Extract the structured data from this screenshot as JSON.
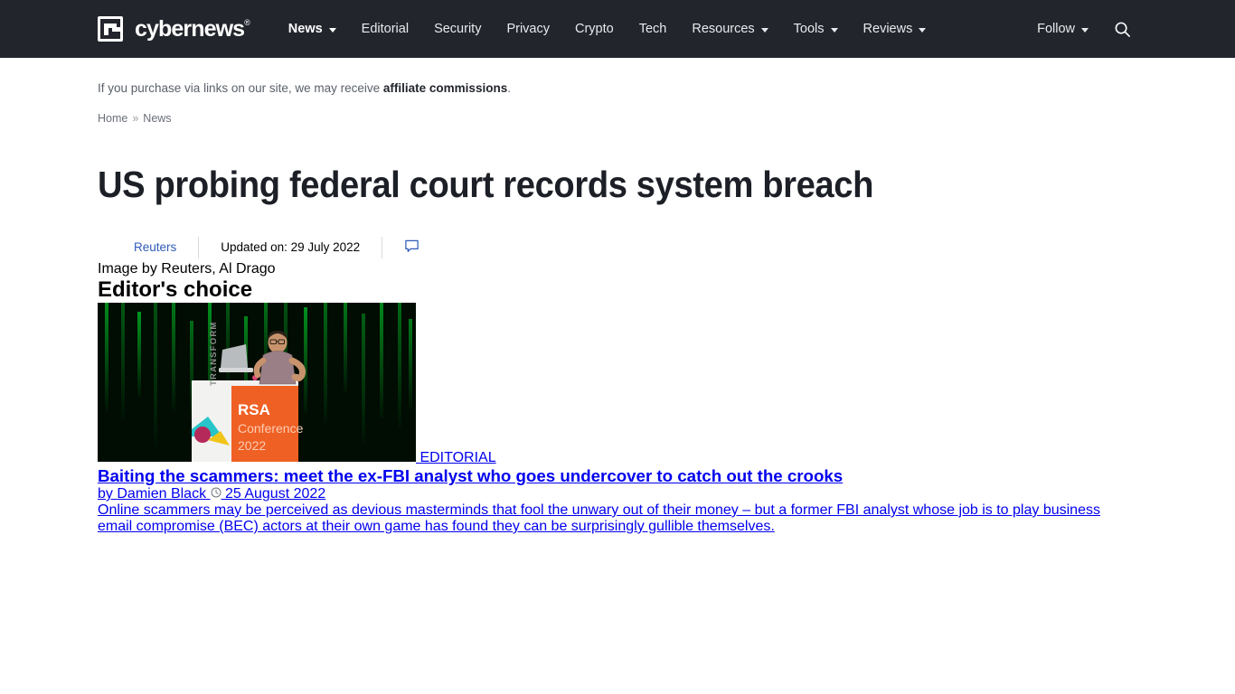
{
  "header": {
    "brand": {
      "name": "cybernews",
      "registered_mark": "®",
      "logo_icon": "cybernews-logo-icon"
    },
    "nav": [
      {
        "label": "News",
        "has_dropdown": true,
        "active": true
      },
      {
        "label": "Editorial",
        "has_dropdown": false,
        "active": false
      },
      {
        "label": "Security",
        "has_dropdown": false,
        "active": false
      },
      {
        "label": "Privacy",
        "has_dropdown": false,
        "active": false
      },
      {
        "label": "Crypto",
        "has_dropdown": false,
        "active": false
      },
      {
        "label": "Tech",
        "has_dropdown": false,
        "active": false
      },
      {
        "label": "Resources",
        "has_dropdown": true,
        "active": false
      },
      {
        "label": "Tools",
        "has_dropdown": true,
        "active": false
      },
      {
        "label": "Reviews",
        "has_dropdown": true,
        "active": false
      }
    ],
    "follow": {
      "label": "Follow",
      "has_dropdown": true
    },
    "search_icon": "search-icon",
    "background_color": "#22252c"
  },
  "affiliate": {
    "text_before": "If you purchase via links on our site, we may receive ",
    "emphasis": "affiliate commissions",
    "text_after": "."
  },
  "breadcrumb": {
    "items": [
      {
        "label": "Home"
      },
      {
        "label": "News"
      }
    ],
    "separator": "»"
  },
  "article": {
    "title": "US probing federal court records system breach",
    "author": "Reuters",
    "updated_label": "Updated on: 29 July 2022",
    "comment_icon": "comment-bubble-icon",
    "hero_caption": "Image by Reuters, Al Drago"
  },
  "sidebar": {
    "heading": "Editor's choice",
    "card": {
      "badge": "EDITORIAL",
      "title": "Baiting the scammers: meet the ex-FBI analyst who goes undercover to catch out the crooks",
      "by_label": "by",
      "author": "Damien Black",
      "clock_icon": "clock-icon",
      "date": "25 August 2022",
      "excerpt": "Online scammers may be perceived as devious masterminds that fool the unwary out of their money – but a former FBI analyst whose job is to play business email compromise (BEC) actors at their own game has found they can be surprisingly gullible themselves.",
      "image_alt_text": "RSA Conference 2022",
      "image_podium_text_1": "RSA",
      "image_podium_text_2": "Conference",
      "image_podium_text_3": "2022",
      "image_side_text": "TRANSFORM"
    }
  },
  "colors": {
    "header_bg": "#22252c",
    "link_blue": "#2f5bb7",
    "text_dark": "#1c1f26",
    "text_muted": "#5a5f6a",
    "placeholder_gray": "#f5f5f5",
    "matrix_green": "#00cc22",
    "rsa_orange": "#ef6024"
  }
}
